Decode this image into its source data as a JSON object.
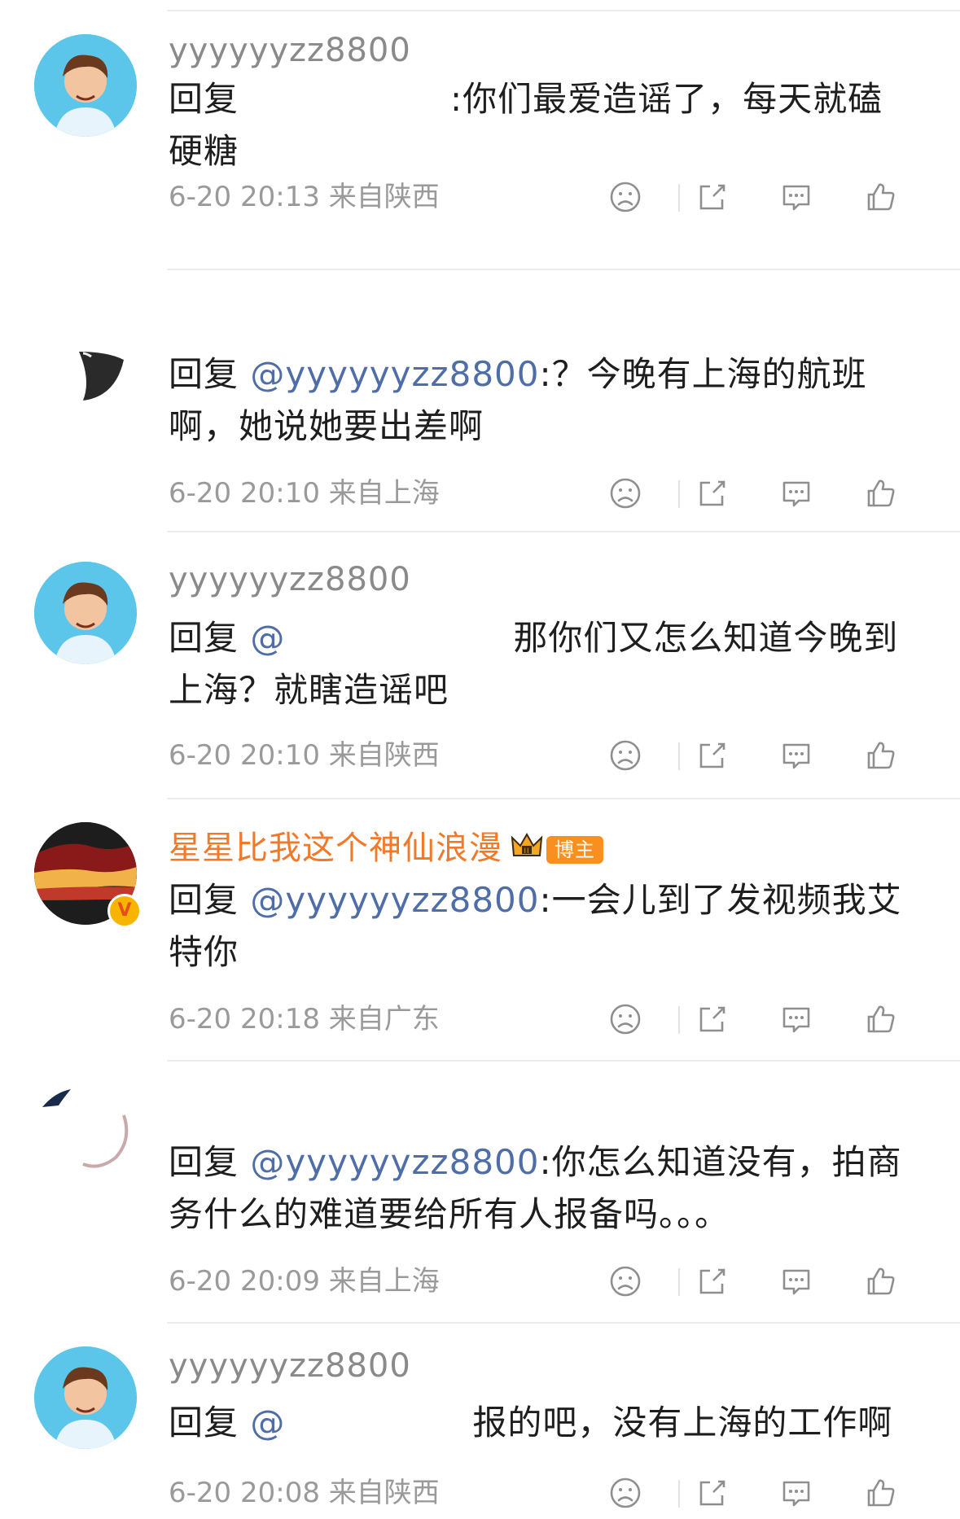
{
  "comments": [
    {
      "username": "yyyyyyzz8800",
      "reply_prefix": "回复",
      "text": ":你们最爱造谣了，每天就磕硬糖",
      "time": "6-20 20:13",
      "location": "来自陕西"
    },
    {
      "username": "",
      "reply_prefix": "回复",
      "mention": "@yyyyyyzz8800",
      "text": ":？今晚有上海的航班啊，她说她要出差啊",
      "time": "6-20 20:10",
      "location": "来自上海"
    },
    {
      "username": "yyyyyyzz8800",
      "reply_prefix": "回复",
      "text": "那你们又怎么知道今晚到上海？就瞎造谣吧",
      "time": "6-20 20:10",
      "location": "来自陕西"
    },
    {
      "username": "星星比我这个神仙浪漫",
      "badge": "博主",
      "reply_prefix": "回复",
      "mention": "@yyyyyyzz8800",
      "text": ":一会儿到了发视频我艾特你",
      "time": "6-20 20:18",
      "location": "来自广东"
    },
    {
      "username": "",
      "reply_prefix": "回复",
      "mention": "@yyyyyyzz8800",
      "text": ":你怎么知道没有，拍商务什么的难道要给所有人报备吗。。。",
      "time": "6-20 20:09",
      "location": "来自上海"
    },
    {
      "username": "yyyyyyzz8800",
      "reply_prefix": "回复",
      "text": "报的吧，没有上海的工作啊",
      "time": "6-20 20:08",
      "location": "来自陕西"
    }
  ],
  "icons": {
    "dislike": "frown-face-icon",
    "share": "share-icon",
    "reply": "comment-bubble-icon",
    "like": "thumbs-up-icon"
  },
  "colors": {
    "mention": "#4f6ea8",
    "vip_name": "#f07a2a",
    "meta": "#9a9a9a"
  }
}
